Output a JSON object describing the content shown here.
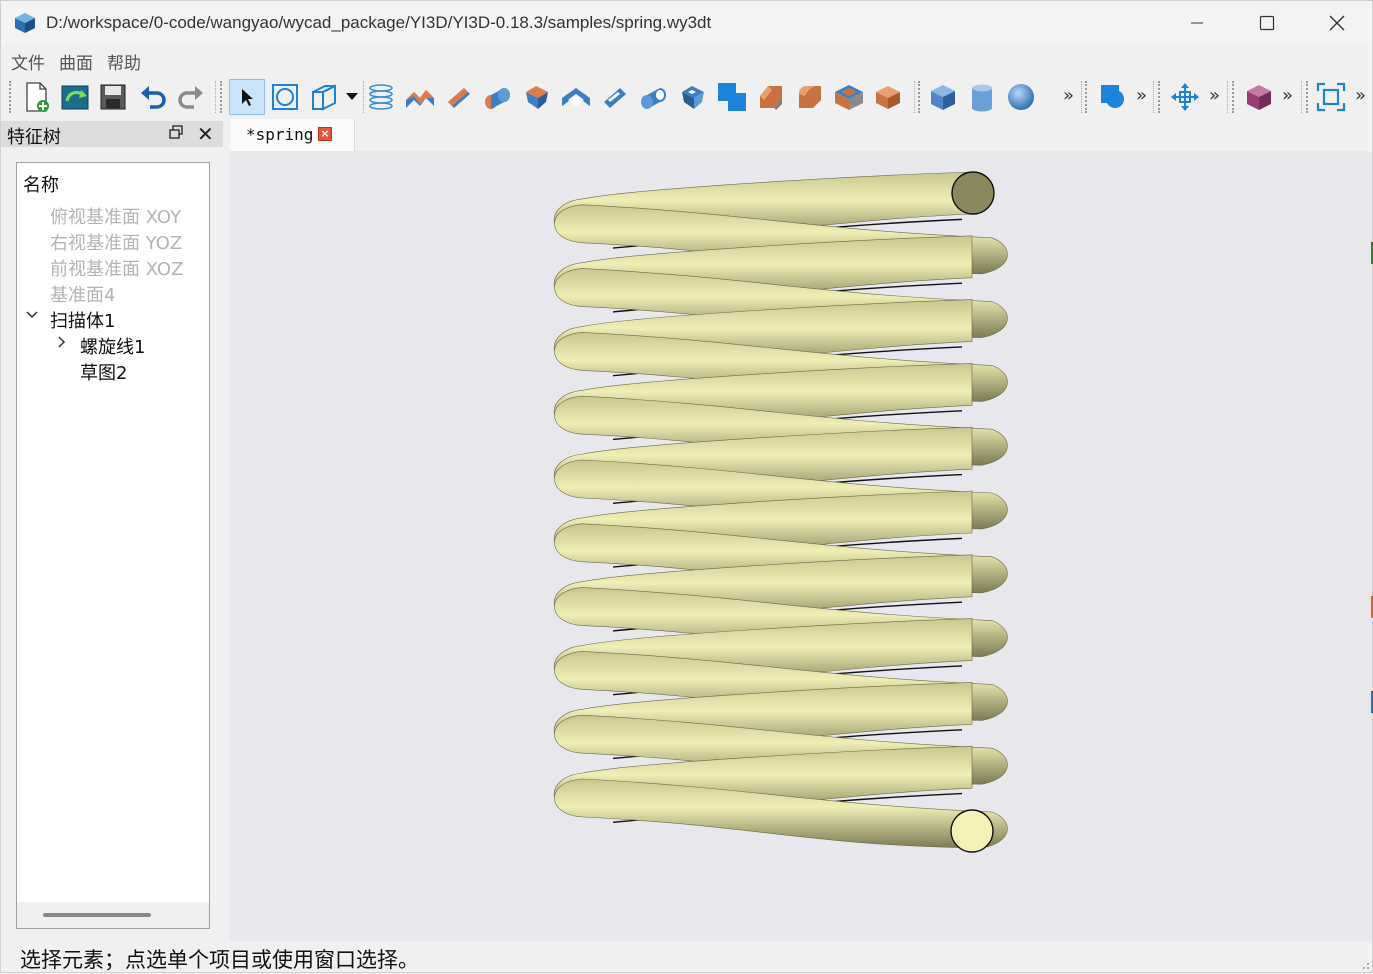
{
  "window": {
    "title": "D:/workspace/0-code/wangyao/wycad_package/YI3D/YI3D-0.18.3/samples/spring.wy3dt"
  },
  "menu": [
    "文件",
    "曲面",
    "帮助"
  ],
  "toolbar": {
    "overflow_label": "»",
    "icons": [
      "new-file-icon",
      "open-file-icon",
      "save-icon",
      "undo-icon",
      "redo-icon",
      "select-cursor-icon",
      "sketch-circle-icon",
      "sketch-plane-icon",
      "helix-icon",
      "extrude-icon",
      "revolve-icon",
      "sweep-icon",
      "loft-icon",
      "extrude-cut-icon",
      "revolve-cut-icon",
      "sweep-cut-icon",
      "loft-cut-icon",
      "boolean-icon",
      "chamfer-icon",
      "fillet-icon",
      "shell-icon",
      "draft-icon",
      "box-primitive-icon",
      "cylinder-primitive-icon",
      "sphere-primitive-icon",
      "shape-icon",
      "move-icon",
      "view-cube-icon",
      "fit-view-icon"
    ]
  },
  "dock": {
    "title": "特征树",
    "tree_header": "名称",
    "items": [
      {
        "label": "俯视基准面 XOY",
        "dim": true
      },
      {
        "label": "右视基准面 YOZ",
        "dim": true
      },
      {
        "label": "前视基准面 XOZ",
        "dim": true
      },
      {
        "label": "基准面4",
        "dim": true
      },
      {
        "label": "扫描体1",
        "dim": false
      },
      {
        "label": "螺旋线1",
        "dim": false
      },
      {
        "label": "草图2",
        "dim": false
      }
    ]
  },
  "tabs": [
    {
      "label": "*spring"
    }
  ],
  "viewport": {
    "model": "spring",
    "coils": 10,
    "color_light": "#f0eeb5",
    "color_dark": "#8f8c5e",
    "background": "#e8e8ec"
  },
  "status": {
    "text": "选择元素；点选单个项目或使用窗口选择。"
  }
}
